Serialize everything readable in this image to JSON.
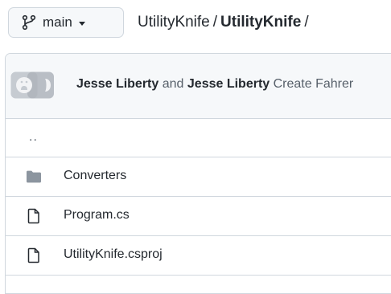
{
  "branch": {
    "label": "main",
    "icon": "git-branch-icon"
  },
  "breadcrumb": {
    "repo": "UtilityKnife",
    "separator": "/",
    "current": "UtilityKnife",
    "trailing": "/"
  },
  "commit": {
    "avatar_icon": "github-avatar-icon",
    "author1": "Jesse Liberty",
    "conjunction": "and",
    "author2": "Jesse Liberty",
    "message": "Create Fahrer"
  },
  "files": {
    "parent": "..",
    "items": [
      {
        "name": "Converters",
        "type": "directory",
        "icon": "folder-icon"
      },
      {
        "name": "Program.cs",
        "type": "file",
        "icon": "file-icon"
      },
      {
        "name": "UtilityKnife.csproj",
        "type": "file",
        "icon": "file-icon"
      }
    ]
  },
  "colors": {
    "border": "#d0d7de",
    "header_bg": "#f6f8fa",
    "folder": "#8c959f"
  }
}
